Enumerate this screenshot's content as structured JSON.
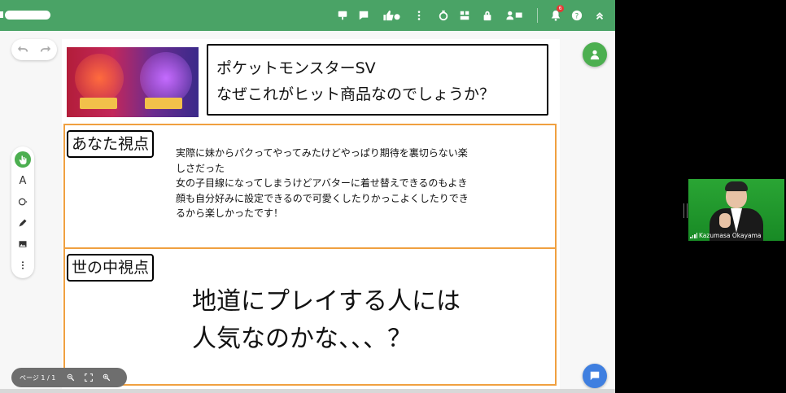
{
  "slide": {
    "title_lines": [
      "ポケットモンスターSV",
      "なぜこれがヒット商品なのでしょうか？"
    ],
    "sections": [
      {
        "label": "あなた視点",
        "lines": [
          "実際に妹からパクってやってみたけどやっぱり期待を裏切らない楽",
          "しさだった",
          "女の子目線になってしまうけどアバターに着せ替えできるのもよき",
          "顔も自分好みに設定できるので可愛くしたりかっこよくしたりでき",
          "るから楽しかったです！"
        ]
      },
      {
        "label": "世の中視点",
        "lines": [
          "地道にプレイする人には",
          "人気なのかな、、、？"
        ]
      }
    ]
  },
  "pager": {
    "label": "ページ 1 / 1"
  },
  "notification": {
    "count": "6"
  },
  "participant": {
    "name": "Kazumasa Okayama"
  },
  "icons": {
    "topbar": [
      "present-icon",
      "comment-icon",
      "thumbs-icon",
      "more-vert-icon",
      "timer-icon",
      "layout-icon",
      "lock-icon",
      "participants-icon",
      "bell-icon",
      "help-icon",
      "collapse-icon"
    ],
    "left_tools": [
      "select-hand-icon",
      "text-icon",
      "shape-icon",
      "pen-icon",
      "image-icon",
      "more-vert-icon"
    ]
  },
  "colors": {
    "topbar": "#4aa366",
    "accent_green": "#4caf50",
    "orange_frame": "#f0a040",
    "chat_blue": "#3f7fe0"
  }
}
